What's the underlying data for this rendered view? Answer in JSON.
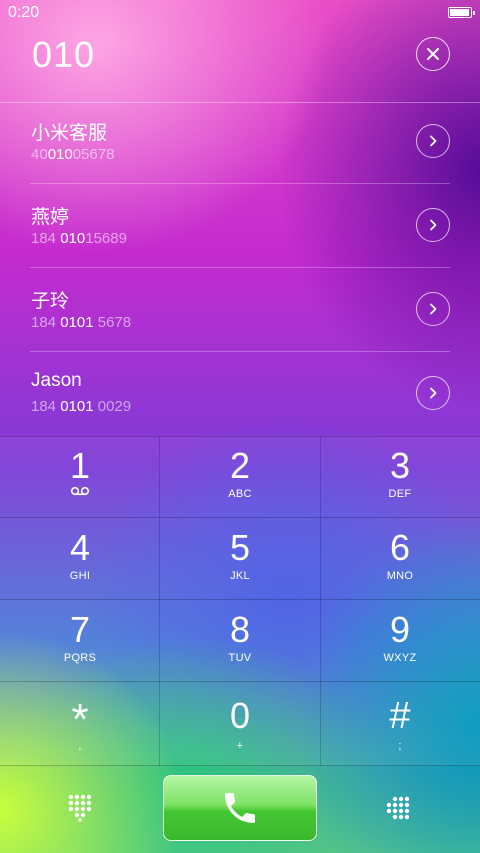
{
  "status_bar": {
    "time": "0:20",
    "battery_level": 0.95
  },
  "dial": {
    "number": "010"
  },
  "results": [
    {
      "name": "小米客服",
      "number_parts": [
        {
          "t": "40",
          "h": false
        },
        {
          "t": "010",
          "h": true
        },
        {
          "t": "05678",
          "h": false
        }
      ]
    },
    {
      "name": "燕婷",
      "number_parts": [
        {
          "t": "184 ",
          "h": false
        },
        {
          "t": "010",
          "h": true
        },
        {
          "t": "15689",
          "h": false
        }
      ]
    },
    {
      "name": "子玲",
      "number_parts": [
        {
          "t": "184 ",
          "h": false
        },
        {
          "t": "0101",
          "h": true
        },
        {
          "t": " 5678",
          "h": false
        }
      ]
    },
    {
      "name": "Jason",
      "number_parts": [
        {
          "t": "184 ",
          "h": false
        },
        {
          "t": "0101",
          "h": true
        },
        {
          "t": " 0029",
          "h": false
        }
      ]
    }
  ],
  "keypad": {
    "keys": [
      {
        "digit": "1",
        "letters": "",
        "icon": "voicemail-icon"
      },
      {
        "digit": "2",
        "letters": "ABC"
      },
      {
        "digit": "3",
        "letters": "DEF"
      },
      {
        "digit": "4",
        "letters": "GHI"
      },
      {
        "digit": "5",
        "letters": "JKL"
      },
      {
        "digit": "6",
        "letters": "MNO"
      },
      {
        "digit": "7",
        "letters": "PQRS"
      },
      {
        "digit": "8",
        "letters": "TUV"
      },
      {
        "digit": "9",
        "letters": "WXYZ"
      },
      {
        "digit": "*",
        "letters": ","
      },
      {
        "digit": "0",
        "letters": "+"
      },
      {
        "digit": "#",
        "letters": ";"
      }
    ]
  },
  "bottom": {
    "left_icon": "dialpad-collapse-icon",
    "call_icon": "phone-handset-icon",
    "right_icon": "dialpad-menu-icon"
  },
  "colors": {
    "call_green": "#45c733",
    "accent_pink": "#e94ec6",
    "accent_purple": "#7b3bd6"
  }
}
